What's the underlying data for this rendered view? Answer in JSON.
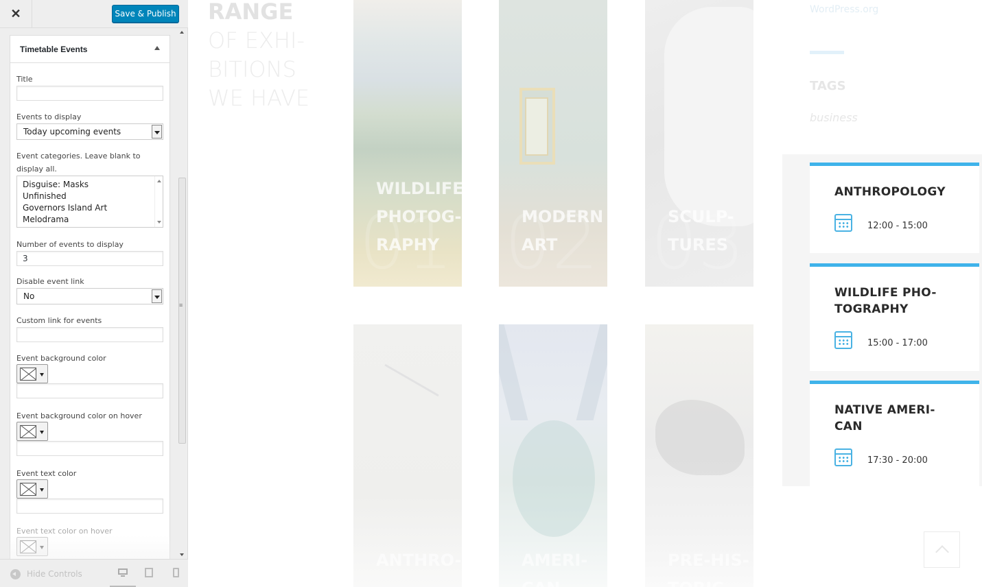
{
  "sidebar": {
    "save_label": "Save & Publish",
    "close_glyph": "✕",
    "section_title": "Timetable Events",
    "fields": {
      "title_label": "Title",
      "title_value": "",
      "events_to_display_label": "Events to display",
      "events_to_display_value": "Today upcoming events",
      "categories_label": "Event categories. Leave blank to display all.",
      "categories": [
        "Disguise: Masks",
        "Unfinished",
        "Governors Island Art",
        "Melodrama"
      ],
      "number_label": "Number of events to display",
      "number_value": "3",
      "disable_link_label": "Disable event link",
      "disable_link_value": "No",
      "custom_link_label": "Custom link for events",
      "custom_link_value": "",
      "bg_color_label": "Event background color",
      "bg_color_hover_label": "Event background color on hover",
      "text_color_label": "Event text color",
      "text_color_hover_label": "Event text color on hover"
    },
    "footer": {
      "hide_controls": "Hide Controls",
      "devices": [
        "desktop-icon",
        "tablet-icon",
        "mobile-icon"
      ]
    }
  },
  "preview": {
    "heading_strong": "RANGE",
    "heading_lines": [
      "OF EXHI-",
      "BITIONS",
      "WE HAVE"
    ],
    "tiles": [
      {
        "number": "01",
        "label_lines": [
          "WILDLIFE",
          "PHOTOG-",
          "RAPHY"
        ]
      },
      {
        "number": "02",
        "label_lines": [
          "MODERN",
          "ART"
        ]
      },
      {
        "number": "03",
        "label_lines": [
          "SCULP-",
          "TURES"
        ]
      },
      {
        "number": "",
        "label_lines": [
          "ANTHRO-"
        ]
      },
      {
        "number": "",
        "label_lines": [
          "AMERI-",
          "CAN"
        ]
      },
      {
        "number": "",
        "label_lines": [
          "PRE-HIS-",
          "TORIC"
        ]
      }
    ],
    "sidebar_link": "WordPress.org",
    "tags_title": "TAGS",
    "tag": "business",
    "events": [
      {
        "title": "ANTHROPOLOGY",
        "time": "12:00 - 15:00"
      },
      {
        "title": "WILDLIFE PHO- TOGRAPHY",
        "title_lines": [
          "WILDLIFE PHO-",
          "TOGRAPHY"
        ],
        "time": "15:00 - 17:00"
      },
      {
        "title": "NATIVE AMERI- CAN",
        "title_lines": [
          "NATIVE AMERI-",
          "CAN"
        ],
        "time": "17:30 - 20:00"
      }
    ],
    "accent_color": "#3fb3ea",
    "back_to_top_icon": "chevron-up-icon"
  }
}
